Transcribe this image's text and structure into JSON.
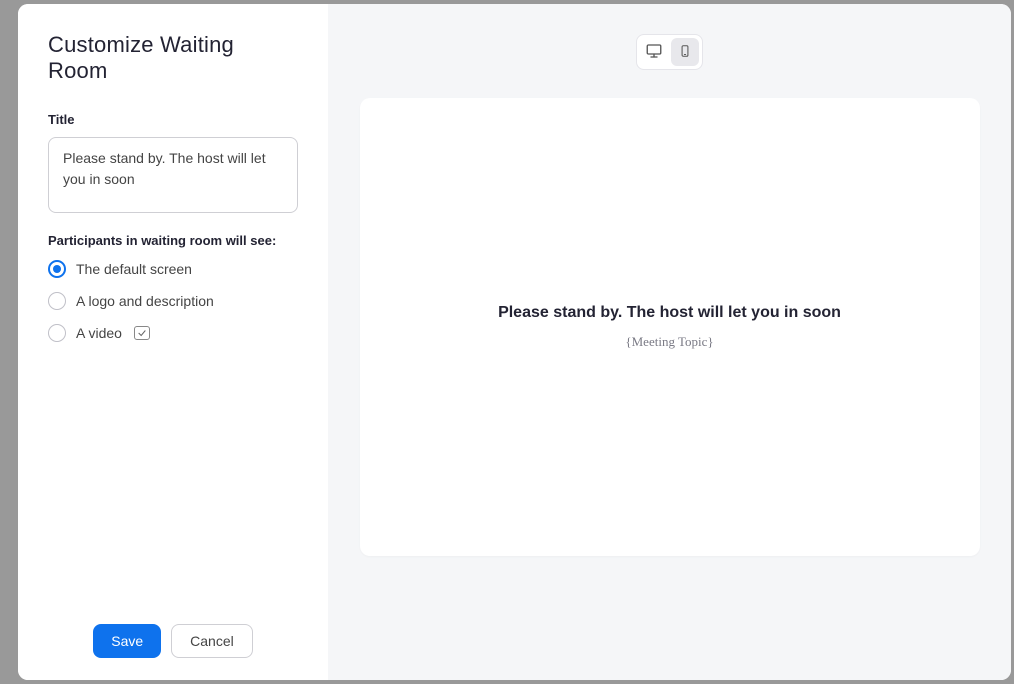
{
  "modal": {
    "title": "Customize Waiting Room",
    "title_field_label": "Title",
    "title_value": "Please stand by. The host will let you in soon",
    "participants_label": "Participants in waiting room will see:",
    "options": {
      "default_screen": "The default screen",
      "logo_description": "A logo and description",
      "a_video": "A video"
    },
    "save_label": "Save",
    "cancel_label": "Cancel"
  },
  "preview": {
    "title": "Please stand by. The host will let you in soon",
    "subtitle": "{Meeting Topic}"
  }
}
